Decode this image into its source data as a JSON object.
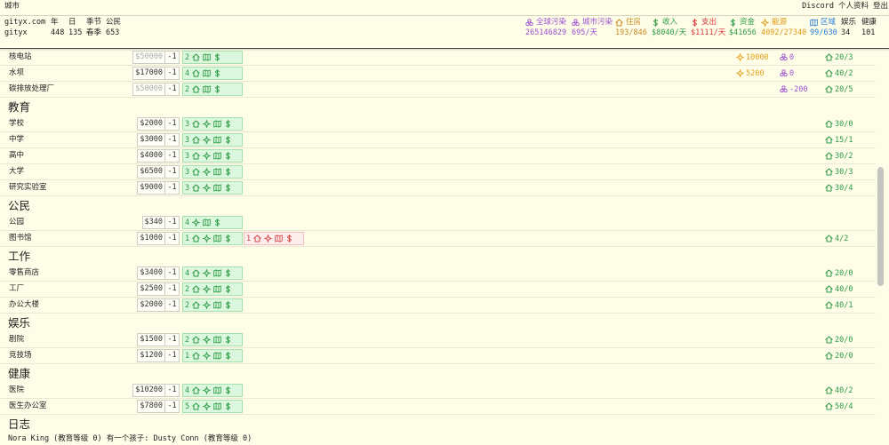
{
  "topbar": {
    "title": "城市",
    "links": [
      "Discord",
      "个人资料",
      "登出"
    ]
  },
  "summary": {
    "site": "gityx.com",
    "city": "gityx",
    "year_label": "年",
    "year": "448",
    "day_label": "日",
    "day": "135",
    "season_label": "季节",
    "season": "春季",
    "citizens_label": "公民",
    "citizens": "653"
  },
  "stats": [
    {
      "label": "全球污染",
      "value": "265146829",
      "icon": "pollution-icon",
      "color": "#9b4fd1"
    },
    {
      "label": "城市污染",
      "value": "695/天",
      "icon": "pollution-icon",
      "color": "#9b4fd1"
    },
    {
      "label": "住房",
      "value": "193/846",
      "icon": "house-icon",
      "color": "#c98a1f"
    },
    {
      "label": "收入",
      "value": "$8040/天",
      "icon": "dollar-icon",
      "color": "#2e9a45"
    },
    {
      "label": "支出",
      "value": "$1111/天",
      "icon": "dollar-icon",
      "color": "#d93b3b"
    },
    {
      "label": "资金",
      "value": "$41656",
      "icon": "dollar-icon",
      "color": "#2e9a45"
    },
    {
      "label": "能源",
      "value": "4092/27340",
      "icon": "energy-icon",
      "color": "#e09a14"
    },
    {
      "label": "区域",
      "value": "99/630",
      "icon": "map-icon",
      "color": "#2f7fd6"
    },
    {
      "label": "娱乐",
      "value": "34",
      "icon": "",
      "color": "#222222"
    },
    {
      "label": "健康",
      "value": "101",
      "icon": "",
      "color": "#222222"
    }
  ],
  "palette": {
    "background": "#fefde8",
    "ok_box_bg": "#dbf8de",
    "ok_box_border": "#a6e0ae",
    "ok_text": "#2e9a45",
    "bad_box_bg": "#fdeeed",
    "bad_box_border": "#f0bfbf",
    "bad_text": "#d64646",
    "energy": "#e2a21a",
    "pollution": "#9b4fd1",
    "workers": "#2e9a45"
  },
  "buildings": {
    "decrement_label": "-1",
    "sections": [
      {
        "rows": [
          {
            "name": "核电站",
            "price": "$50000",
            "affordable": false,
            "boxes": [
              {
                "count": "2",
                "ok": true,
                "icons": [
                  "house-icon",
                  "map-icon",
                  "dollar-icon"
                ]
              }
            ],
            "energy": "10000",
            "pollution": "0",
            "workers": "20/3"
          },
          {
            "name": "水坝",
            "price": "$17000",
            "affordable": true,
            "boxes": [
              {
                "count": "4",
                "ok": true,
                "icons": [
                  "house-icon",
                  "map-icon",
                  "dollar-icon"
                ]
              }
            ],
            "energy": "5200",
            "pollution": "0",
            "workers": "40/2"
          },
          {
            "name": "碳排放处理厂",
            "price": "$50000",
            "affordable": false,
            "boxes": [
              {
                "count": "2",
                "ok": true,
                "icons": [
                  "house-icon",
                  "map-icon",
                  "dollar-icon"
                ]
              }
            ],
            "pollution": "-200",
            "workers": "20/5"
          }
        ]
      },
      {
        "heading": "教育",
        "rows": [
          {
            "name": "学校",
            "price": "$2000",
            "affordable": true,
            "boxes": [
              {
                "count": "3",
                "ok": true,
                "icons": [
                  "house-icon",
                  "energy-icon",
                  "map-icon",
                  "dollar-icon"
                ]
              }
            ],
            "workers": "30/0"
          },
          {
            "name": "中学",
            "price": "$3000",
            "affordable": true,
            "boxes": [
              {
                "count": "3",
                "ok": true,
                "icons": [
                  "house-icon",
                  "energy-icon",
                  "map-icon",
                  "dollar-icon"
                ]
              }
            ],
            "workers": "15/1"
          },
          {
            "name": "高中",
            "price": "$4000",
            "affordable": true,
            "boxes": [
              {
                "count": "3",
                "ok": true,
                "icons": [
                  "house-icon",
                  "energy-icon",
                  "map-icon",
                  "dollar-icon"
                ]
              }
            ],
            "workers": "30/2"
          },
          {
            "name": "大学",
            "price": "$6500",
            "affordable": true,
            "boxes": [
              {
                "count": "3",
                "ok": true,
                "icons": [
                  "house-icon",
                  "energy-icon",
                  "map-icon",
                  "dollar-icon"
                ]
              }
            ],
            "workers": "30/3"
          },
          {
            "name": "研究实验室",
            "price": "$9000",
            "affordable": true,
            "boxes": [
              {
                "count": "3",
                "ok": true,
                "icons": [
                  "house-icon",
                  "energy-icon",
                  "map-icon",
                  "dollar-icon"
                ]
              }
            ],
            "workers": "30/4"
          }
        ]
      },
      {
        "heading": "公民",
        "rows": [
          {
            "name": "公园",
            "price": "$340",
            "affordable": true,
            "boxes": [
              {
                "count": "4",
                "ok": true,
                "icons": [
                  "energy-icon",
                  "map-icon",
                  "dollar-icon"
                ]
              }
            ]
          },
          {
            "name": "图书馆",
            "price": "$1000",
            "affordable": true,
            "boxes": [
              {
                "count": "1",
                "ok": true,
                "icons": [
                  "house-icon",
                  "energy-icon",
                  "map-icon",
                  "dollar-icon"
                ]
              },
              {
                "count": "1",
                "ok": false,
                "icons": [
                  "house-icon",
                  "energy-icon",
                  "map-icon",
                  "dollar-icon"
                ]
              }
            ],
            "workers": "4/2"
          }
        ]
      },
      {
        "heading": "工作",
        "rows": [
          {
            "name": "零售商店",
            "price": "$3400",
            "affordable": true,
            "boxes": [
              {
                "count": "4",
                "ok": true,
                "icons": [
                  "house-icon",
                  "energy-icon",
                  "map-icon",
                  "dollar-icon"
                ]
              }
            ],
            "workers": "20/0"
          },
          {
            "name": "工厂",
            "price": "$2500",
            "affordable": true,
            "boxes": [
              {
                "count": "2",
                "ok": true,
                "icons": [
                  "house-icon",
                  "energy-icon",
                  "map-icon",
                  "dollar-icon"
                ]
              }
            ],
            "workers": "40/0"
          },
          {
            "name": "办公大楼",
            "price": "$2000",
            "affordable": true,
            "boxes": [
              {
                "count": "2",
                "ok": true,
                "icons": [
                  "house-icon",
                  "energy-icon",
                  "map-icon",
                  "dollar-icon"
                ]
              }
            ],
            "workers": "40/1"
          }
        ]
      },
      {
        "heading": "娱乐",
        "rows": [
          {
            "name": "剧院",
            "price": "$1500",
            "affordable": true,
            "boxes": [
              {
                "count": "2",
                "ok": true,
                "icons": [
                  "house-icon",
                  "energy-icon",
                  "map-icon",
                  "dollar-icon"
                ]
              }
            ],
            "workers": "20/0"
          },
          {
            "name": "竞技场",
            "price": "$1200",
            "affordable": true,
            "boxes": [
              {
                "count": "1",
                "ok": true,
                "icons": [
                  "house-icon",
                  "energy-icon",
                  "map-icon",
                  "dollar-icon"
                ]
              }
            ],
            "workers": "20/0"
          }
        ]
      },
      {
        "heading": "健康",
        "rows": [
          {
            "name": "医院",
            "price": "$10200",
            "affordable": true,
            "boxes": [
              {
                "count": "4",
                "ok": true,
                "icons": [
                  "house-icon",
                  "energy-icon",
                  "map-icon",
                  "dollar-icon"
                ]
              }
            ],
            "workers": "40/2"
          },
          {
            "name": "医生办公室",
            "price": "$7800",
            "affordable": true,
            "boxes": [
              {
                "count": "5",
                "ok": true,
                "icons": [
                  "house-icon",
                  "energy-icon",
                  "map-icon",
                  "dollar-icon"
                ]
              }
            ],
            "workers": "50/4"
          }
        ]
      }
    ]
  },
  "log": {
    "heading": "日志",
    "entries": [
      "Nora King (教育等级 0) 有一个孩子: Dusty Conn (教育等级 0)"
    ]
  }
}
